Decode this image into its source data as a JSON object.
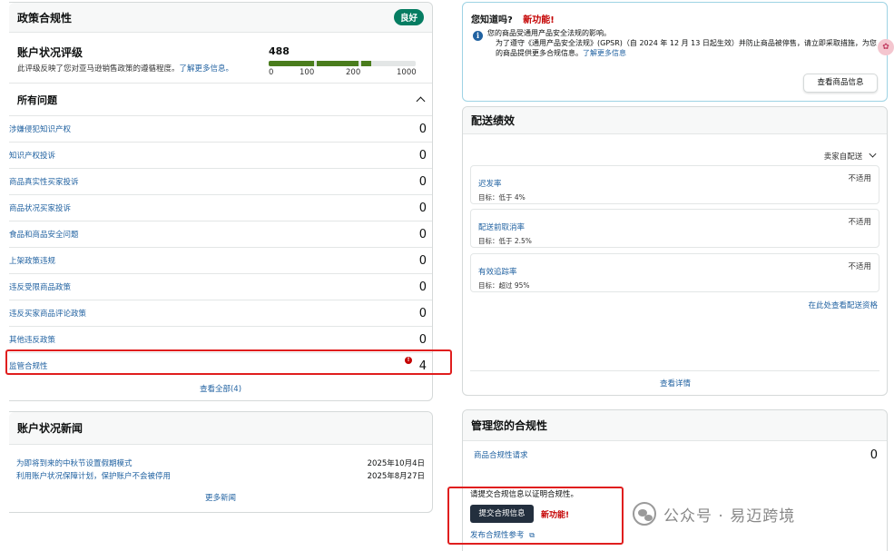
{
  "policy": {
    "title": "政策合规性",
    "badge": "良好",
    "health_title": "账户状况评级",
    "health_desc": "此评级反映了您对亚马逊销售政策的遵循程度。",
    "health_link": "了解更多信息。",
    "score": "488",
    "score_fraction": 0.488,
    "ticks": [
      "0",
      "100",
      "200",
      "1000"
    ],
    "issues_title": "所有问题",
    "issues": [
      {
        "label": "涉嫌侵犯知识产权",
        "value": "0"
      },
      {
        "label": "知识产权投诉",
        "value": "0"
      },
      {
        "label": "商品真实性买家投诉",
        "value": "0"
      },
      {
        "label": "商品状况买家投诉",
        "value": "0"
      },
      {
        "label": "食品和商品安全问题",
        "value": "0"
      },
      {
        "label": "上架政策违规",
        "value": "0"
      },
      {
        "label": "违反受限商品政策",
        "value": "0"
      },
      {
        "label": "违反买家商品评论政策",
        "value": "0"
      },
      {
        "label": "其他违反政策",
        "value": "0"
      },
      {
        "label": "监管合规性",
        "value": "4",
        "alert": "!"
      }
    ],
    "view_all": "查看全部(4)"
  },
  "news": {
    "title": "账户状况新闻",
    "items": [
      {
        "text": "为即将到来的中秋节设置假期模式",
        "date": "2025年10月4日"
      },
      {
        "text": "利用账户状况保障计划，保护账户不会被停用",
        "date": "2025年8月27日"
      }
    ],
    "more": "更多新闻"
  },
  "did_you_know": {
    "title": "您知道吗?",
    "new_label": "新功能!",
    "line1": "您的商品受通用产品安全法规的影响。",
    "line2": "为了遵守《通用产品安全法规》(GPSR)（自 2024 年 12 月 13 日起生效）并防止商品被停售，请立即采取措施，为您的商品提供更多合规信息。",
    "link": "了解更多信息",
    "button": "查看商品信息"
  },
  "shipping": {
    "title": "配送绩效",
    "filter": "卖家自配送",
    "metrics": [
      {
        "name": "迟发率",
        "goal": "目标：低于 4%",
        "status": "不适用"
      },
      {
        "name": "配送前取消率",
        "goal": "目标：低于 2.5%",
        "status": "不适用"
      },
      {
        "name": "有效追踪率",
        "goal": "目标：超过 95%",
        "status": "不适用"
      }
    ],
    "eligibility_link": "在此处查看配送资格",
    "details": "查看详情"
  },
  "manage": {
    "title": "管理您的合规性",
    "request_label": "商品合规性请求",
    "request_value": "0",
    "prompt": "请提交合规信息以证明合规性。",
    "submit_button": "提交合规信息",
    "new_label": "新功能!",
    "reference_link": "发布合规性参考"
  },
  "watermark": {
    "text": "公众号 · 易迈跨境"
  },
  "colors": {
    "link": "#2162a1",
    "good_badge": "#067d62",
    "bar_fill": "#4a7d1d",
    "alert_red": "#c40000",
    "highlight_box": "#e01e1e"
  }
}
